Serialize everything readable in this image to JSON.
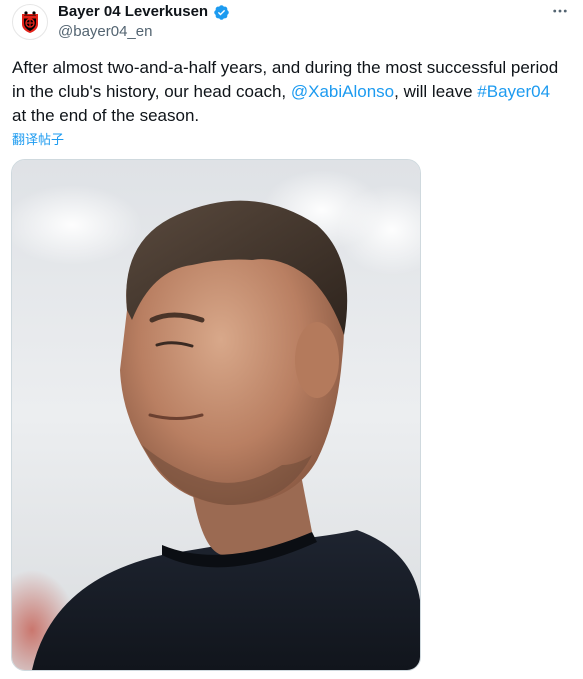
{
  "author": {
    "display_name": "Bayer 04 Leverkusen",
    "handle": "@bayer04_en",
    "verified": true,
    "avatar_icon": "bayer-04-crest-icon",
    "verified_icon": "verified-badge-icon",
    "verified_color": "#1d9bf0"
  },
  "tweet": {
    "text_1": "After almost two-and-a-half years, and during the most successful period in the club's history, our head coach, ",
    "mention": "@XabiAlonso",
    "text_2": ", will leave ",
    "hashtag": "#Bayer04",
    "text_3": " at the end of the season.",
    "translate_label": "翻译帖子",
    "link_color": "#1d9bf0"
  },
  "media": {
    "type": "photo",
    "subject": "portrait-photo"
  },
  "more_icon": "more-dots-icon"
}
